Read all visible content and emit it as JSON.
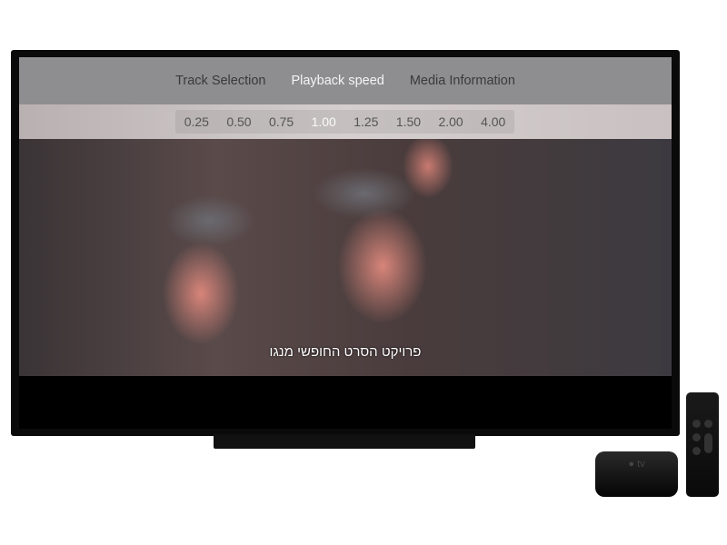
{
  "menu": {
    "tabs": [
      {
        "label": "Track Selection",
        "active": false
      },
      {
        "label": "Playback speed",
        "active": true
      },
      {
        "label": "Media Information",
        "active": false
      }
    ]
  },
  "playback_speed": {
    "options": [
      "0.25",
      "0.50",
      "0.75",
      "1.00",
      "1.25",
      "1.50",
      "2.00",
      "4.00"
    ],
    "selected": "1.00"
  },
  "video": {
    "subtitle": "פרויקט הסרט החופשי מנגו"
  },
  "device": {
    "logo": "tv"
  }
}
